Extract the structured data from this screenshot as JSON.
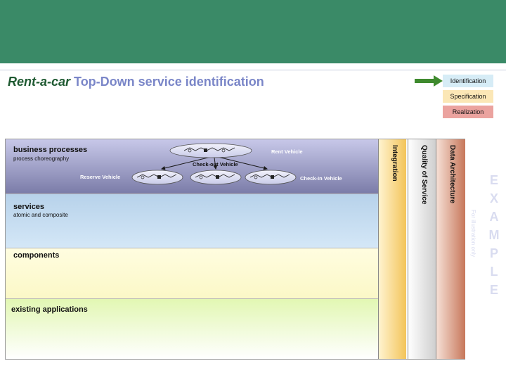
{
  "title": {
    "brand": "Rent-a-car",
    "rest": " Top-Down service identification"
  },
  "legend": {
    "identification": "Identification",
    "specification": "Specification",
    "realization": "Realization",
    "colors": {
      "identification": "#d6ecf6",
      "specification": "#fbe7b6",
      "realization": "#eba39f",
      "arrow": "#3f8a2e"
    }
  },
  "layers": {
    "business_processes": {
      "title": "business processes",
      "subtitle": "process choreography"
    },
    "services": {
      "title": "services",
      "subtitle": "atomic and composite"
    },
    "components": {
      "title": "components"
    },
    "existing_applications": {
      "title": "existing applications"
    }
  },
  "columns": {
    "integration": "Integration",
    "quality_of_service": "Quality of Service",
    "data_architecture": "Data Architecture"
  },
  "processes": {
    "rent_vehicle": "Rent Vehicle",
    "check_out_vehicle": "Check-out Vehicle",
    "reserve_vehicle": "Reserve Vehicle",
    "check_in_vehicle": "Check-In Vehicle"
  },
  "watermark": {
    "letters": [
      "E",
      "X",
      "A",
      "M",
      "P",
      "L",
      "E"
    ],
    "note": "For illustration only"
  },
  "header_color": "#3a8a67"
}
